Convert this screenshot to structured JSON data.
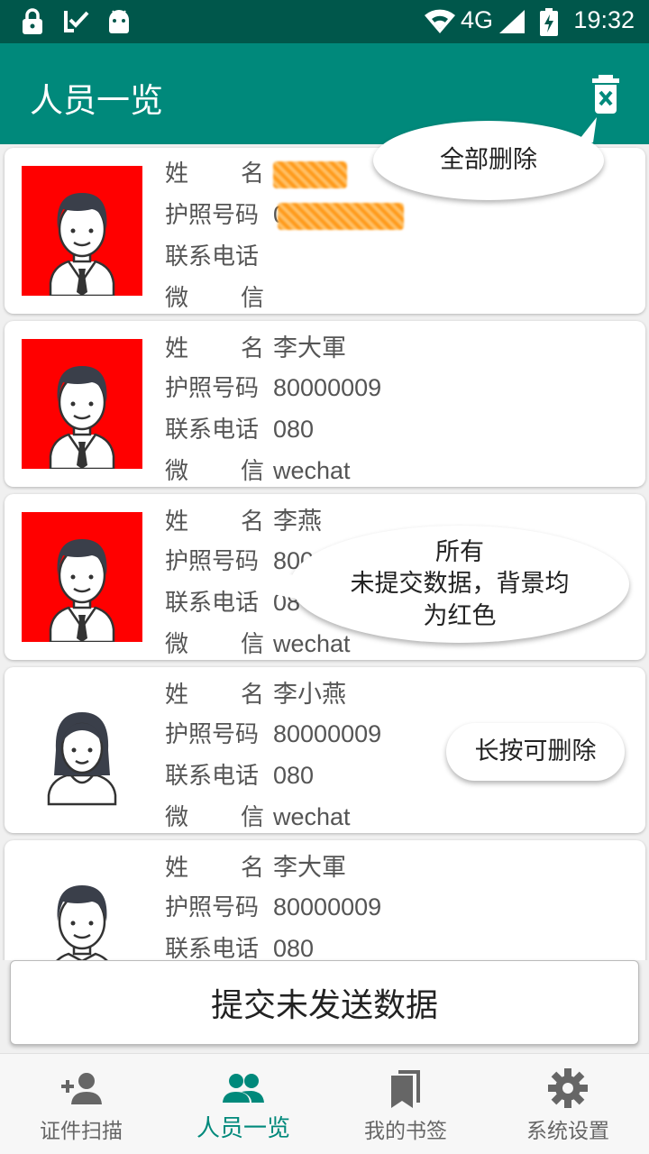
{
  "status_bar": {
    "time": "19:32",
    "network": "4G"
  },
  "app_bar": {
    "title": "人员一览",
    "delete_all_icon": "trash-icon"
  },
  "persons": [
    {
      "name_label": "姓名",
      "name": "",
      "passport_label": "护照号码",
      "passport": "0",
      "phone_label": "联系电话",
      "phone": "",
      "wechat_label": "微信",
      "wechat": "",
      "avatar": "male",
      "unsubmitted": true
    },
    {
      "name_label": "姓名",
      "name": "李大軍",
      "passport_label": "护照号码",
      "passport": "80000009",
      "phone_label": "联系电话",
      "phone": "080",
      "wechat_label": "微信",
      "wechat": "wechat",
      "avatar": "male",
      "unsubmitted": true
    },
    {
      "name_label": "姓名",
      "name": "李燕",
      "passport_label": "护照号码",
      "passport": "800",
      "phone_label": "联系电话",
      "phone": "08",
      "wechat_label": "微信",
      "wechat": "wechat",
      "avatar": "male",
      "unsubmitted": true
    },
    {
      "name_label": "姓名",
      "name": "李小燕",
      "passport_label": "护照号码",
      "passport": "80000009",
      "phone_label": "联系电话",
      "phone": "080",
      "wechat_label": "微信",
      "wechat": "wechat",
      "avatar": "female",
      "unsubmitted": false
    },
    {
      "name_label": "姓名",
      "name": "李大軍",
      "passport_label": "护照号码",
      "passport": "80000009",
      "phone_label": "联系电话",
      "phone": "080",
      "wechat_label": "微信",
      "wechat": "",
      "avatar": "male",
      "unsubmitted": false
    }
  ],
  "callouts": {
    "delete_all": "全部删除",
    "red_bg_line1": "所有",
    "red_bg_line2": "未提交数据，背景均",
    "red_bg_line3": "为红色",
    "long_press": "长按可删除"
  },
  "submit_button": "提交未发送数据",
  "bottom_nav": [
    {
      "label": "证件扫描",
      "icon": "add-person-icon",
      "active": false
    },
    {
      "label": "人员一览",
      "icon": "people-icon",
      "active": true
    },
    {
      "label": "我的书签",
      "icon": "bookmark-icon",
      "active": false
    },
    {
      "label": "系统设置",
      "icon": "gear-icon",
      "active": false
    }
  ],
  "colors": {
    "status_bar": "#00574b",
    "app_bar": "#00897b",
    "unsubmitted_bg": "#ff0000",
    "accent": "#00897b"
  }
}
